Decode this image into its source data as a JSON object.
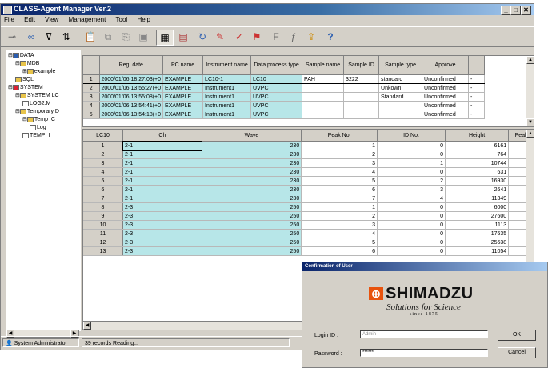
{
  "window": {
    "title": "CLASS-Agent Manager Ver.2",
    "controls": [
      "_",
      "□",
      "✕"
    ]
  },
  "menu": [
    "File",
    "Edit",
    "View",
    "Management",
    "Tool",
    "Help"
  ],
  "tree": {
    "items": [
      {
        "label": "DATA",
        "level": 0,
        "exp": "⊟"
      },
      {
        "label": "MDB",
        "level": 1,
        "exp": "⊟"
      },
      {
        "label": "example",
        "level": 2,
        "exp": "⊞"
      },
      {
        "label": "SQL",
        "level": 1,
        "exp": ""
      },
      {
        "label": "SYSTEM",
        "level": 0,
        "exp": "⊟"
      },
      {
        "label": "SYSTEM LC",
        "level": 1,
        "exp": "⊟"
      },
      {
        "label": "LOG2.M",
        "level": 2,
        "exp": ""
      },
      {
        "label": "Temporary D",
        "level": 1,
        "exp": "⊟"
      },
      {
        "label": "Temp_C",
        "level": 2,
        "exp": "⊟"
      },
      {
        "label": "Log",
        "level": 3,
        "exp": ""
      },
      {
        "label": "TEMP_I",
        "level": 2,
        "exp": ""
      }
    ]
  },
  "grid1": {
    "headers": [
      "",
      "Reg. date",
      "PC name",
      "Instrument name",
      "Data process type",
      "Sample name",
      "Sample ID",
      "Sample type",
      "Approve"
    ],
    "rows": [
      [
        "1",
        "2000/01/06 18:27:03(+0",
        "EXAMPLE",
        "LC10-1",
        "LC10",
        "PAH",
        "3222",
        "standard",
        "Unconfirmed",
        "-"
      ],
      [
        "2",
        "2000/01/06 13:55:27(+0",
        "EXAMPLE",
        "Instrument1",
        "UVPC",
        "",
        "",
        "Unkown",
        "Unconfirmed",
        "-"
      ],
      [
        "3",
        "2000/01/06 13:55:08(+0",
        "EXAMPLE",
        "Instrument1",
        "UVPC",
        "",
        "",
        "Standard",
        "Unconfirmed",
        "-"
      ],
      [
        "4",
        "2000/01/06 13:54:41(+0",
        "EXAMPLE",
        "Instrument1",
        "UVPC",
        "",
        "",
        "",
        "Unconfirmed",
        "-"
      ],
      [
        "5",
        "2000/01/06 13:54:18(+0",
        "EXAMPLE",
        "Instrument1",
        "UVPC",
        "",
        "",
        "",
        "Unconfirmed",
        "-"
      ]
    ]
  },
  "grid2": {
    "headers": [
      "LC10",
      "Ch",
      "Wave",
      "Peak No.",
      "ID No.",
      "Height",
      "Peak"
    ],
    "rows": [
      [
        "1",
        "2-1",
        "230",
        "1",
        "0",
        "6161"
      ],
      [
        "2",
        "2-1",
        "230",
        "2",
        "0",
        "764"
      ],
      [
        "3",
        "2-1",
        "230",
        "3",
        "1",
        "10744"
      ],
      [
        "4",
        "2-1",
        "230",
        "4",
        "0",
        "631"
      ],
      [
        "5",
        "2-1",
        "230",
        "5",
        "2",
        "16930"
      ],
      [
        "6",
        "2-1",
        "230",
        "6",
        "3",
        "2641"
      ],
      [
        "7",
        "2-1",
        "230",
        "7",
        "4",
        "11349"
      ],
      [
        "8",
        "2-3",
        "250",
        "1",
        "0",
        "6000"
      ],
      [
        "9",
        "2-3",
        "250",
        "2",
        "0",
        "27600"
      ],
      [
        "10",
        "2-3",
        "250",
        "3",
        "0",
        "1113"
      ],
      [
        "11",
        "2-3",
        "250",
        "4",
        "0",
        "17635"
      ],
      [
        "12",
        "2-3",
        "250",
        "5",
        "0",
        "25638"
      ],
      [
        "13",
        "2-3",
        "250",
        "6",
        "0",
        "11054"
      ]
    ]
  },
  "status": {
    "user": "System Administrator",
    "message": "39 records Reading..."
  },
  "dialog": {
    "title": "Confirmation of User",
    "brand": "SHIMADZU",
    "tagline": "Solutions for Science",
    "since": "since 1875",
    "login_label": "Login ID :",
    "login_value": "Admin",
    "password_label": "Password :",
    "password_value": "******",
    "ok_label": "OK",
    "cancel_label": "Cancel"
  },
  "colors": {
    "title_bar": "#0a246a",
    "grid_highlight": "#b7e6e8",
    "brand_mark": "#e8530e",
    "face": "#d4d0c8"
  }
}
